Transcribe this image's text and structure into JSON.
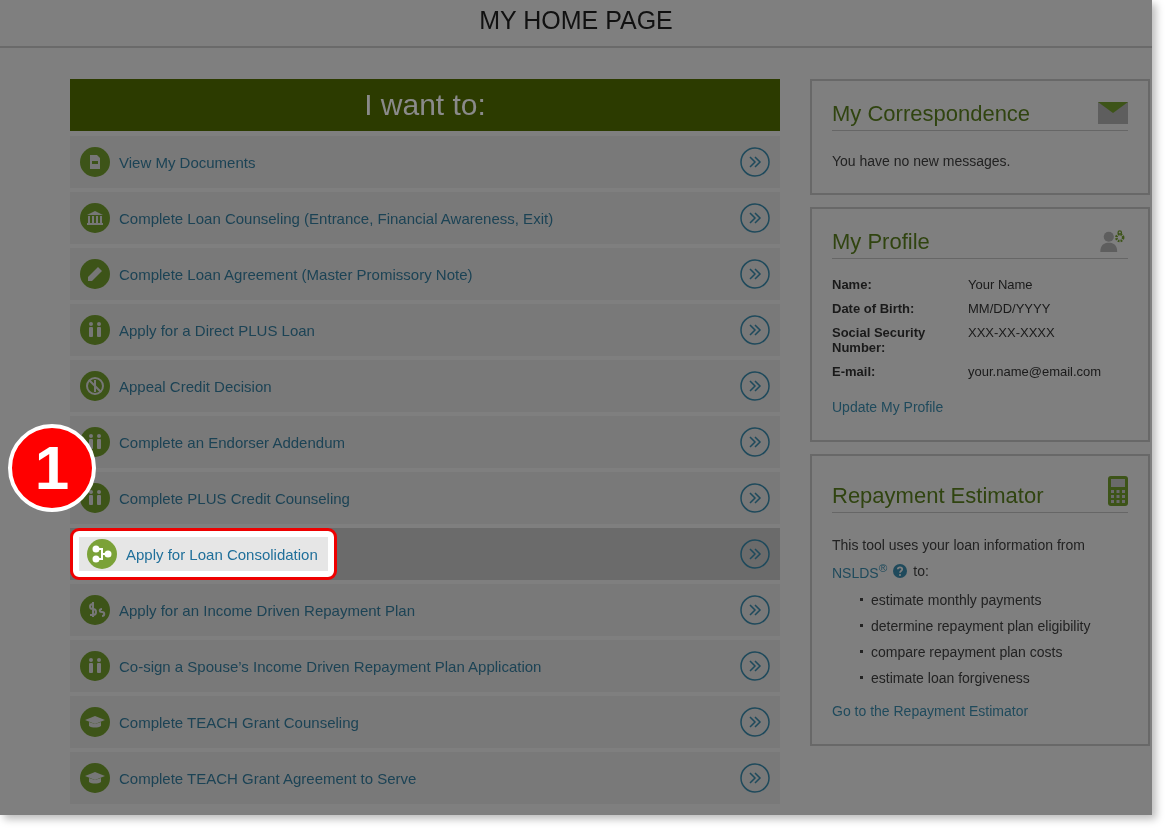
{
  "page_title": "MY HOME PAGE",
  "want": {
    "title": "I want to:",
    "actions": [
      {
        "label": "View My Documents",
        "selected": false
      },
      {
        "label": "Complete Loan Counseling (Entrance, Financial Awareness, Exit)",
        "selected": false
      },
      {
        "label": "Complete Loan Agreement (Master Promissory Note)",
        "selected": false
      },
      {
        "label": "Apply for a Direct PLUS Loan",
        "selected": false
      },
      {
        "label": "Appeal Credit Decision",
        "selected": false
      },
      {
        "label": "Complete an Endorser Addendum",
        "selected": false
      },
      {
        "label": "Complete PLUS Credit Counseling",
        "selected": false
      },
      {
        "label": "Apply for Loan Consolidation",
        "selected": true
      },
      {
        "label": "Apply for an Income Driven Repayment Plan",
        "selected": false
      },
      {
        "label": "Co-sign a Spouse’s Income Driven Repayment Plan Application",
        "selected": false
      },
      {
        "label": "Complete TEACH Grant Counseling",
        "selected": false
      },
      {
        "label": "Complete TEACH Grant Agreement to Serve",
        "selected": false
      }
    ]
  },
  "step_badge": "1",
  "correspondence": {
    "title": "My Correspondence",
    "message": "You have no new messages."
  },
  "profile": {
    "title": "My Profile",
    "fields": [
      {
        "label": "Name:",
        "value": "Your Name"
      },
      {
        "label": "Date of Birth:",
        "value": "MM/DD/YYYY"
      },
      {
        "label": "Social Security Number:",
        "value": "XXX-XX-XXXX"
      },
      {
        "label": "E-mail:",
        "value": "your.name@email.com"
      }
    ],
    "link": "Update My Profile"
  },
  "estimator": {
    "title": "Repayment Estimator",
    "intro": "This tool uses your loan information from",
    "source_link": "NSLDS$^{®}$",
    "after_link": "to:",
    "bullets": [
      "estimate monthly payments",
      "determine repayment plan eligibility",
      "compare repayment plan costs",
      "estimate loan forgiveness"
    ],
    "link": "Go to the Repayment Estimator"
  }
}
